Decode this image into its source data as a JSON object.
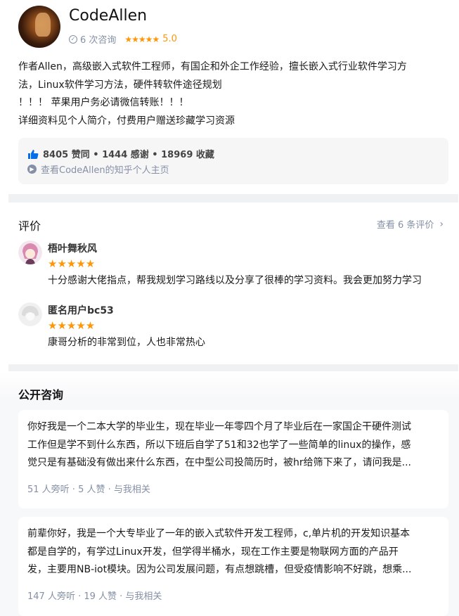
{
  "profile": {
    "name": "CodeAllen",
    "consult_count": "6 次咨询",
    "rating_stars": "★★★★★",
    "rating_score": "5.0",
    "intro_lines": [
      "作者Allen，高级嵌入式软件工程师，有国企和外企工作经验，擅长嵌入式行业软件学习方",
      "法，Linux软件学习方法，硬件转软件途径规划",
      "！！！ 苹果用户务必请微信转账！！！",
      "详细资料见个人简介，付费用户赠送珍藏学习资源"
    ],
    "stats": "8405 赞同 • 1444 感谢 • 18969 收藏",
    "homepage_link": "查看CodeAllen的知乎个人主页"
  },
  "reviews": {
    "title": "评价",
    "view_all": "查看 6 条评价",
    "items": [
      {
        "user": "梧叶舞秋风",
        "stars": "★★★★★",
        "text": "十分感谢大佬指点，帮我规划学习路线以及分享了很棒的学习资料。我会更加努力学习"
      },
      {
        "user": "匿名用户bc53",
        "stars": "★★★★★",
        "text": "康哥分析的非常到位，人也非常热心"
      }
    ]
  },
  "consult": {
    "title": "公开咨询",
    "items": [
      {
        "lines": [
          "你好我是一个二本大学的毕业生，现在毕业一年零四个月了毕业后在一家国企干硬件测试",
          "工作但是学不到什么东西，所以下班后自学了51和32也学了一些简单的linux的操作，感",
          "觉只是有基础没有做出来什么东西，在中型公司投简历时，被hr给筛下来了，请问我是..."
        ],
        "meta": "51 人旁听 · 5 人赞 · 与我相关"
      },
      {
        "lines": [
          "前辈你好，我是一个大专毕业了一年的嵌入式软件开发工程师，c,单片机的开发知识基本",
          "都是自学的，有学过Linux开发，但学得半桶水，现在工作主要是物联网方面的产品开",
          "发，主要用NB-iot模块。因为公司发展问题，有点想跳槽，但受疫情影响不好跳，想乘..."
        ],
        "meta": "147 人旁听 · 19 人赞 · 与我相关"
      }
    ]
  },
  "colors": {
    "accent_blue": "#056de8",
    "star_orange": "#ff9607",
    "muted_gray": "#8590a6"
  }
}
